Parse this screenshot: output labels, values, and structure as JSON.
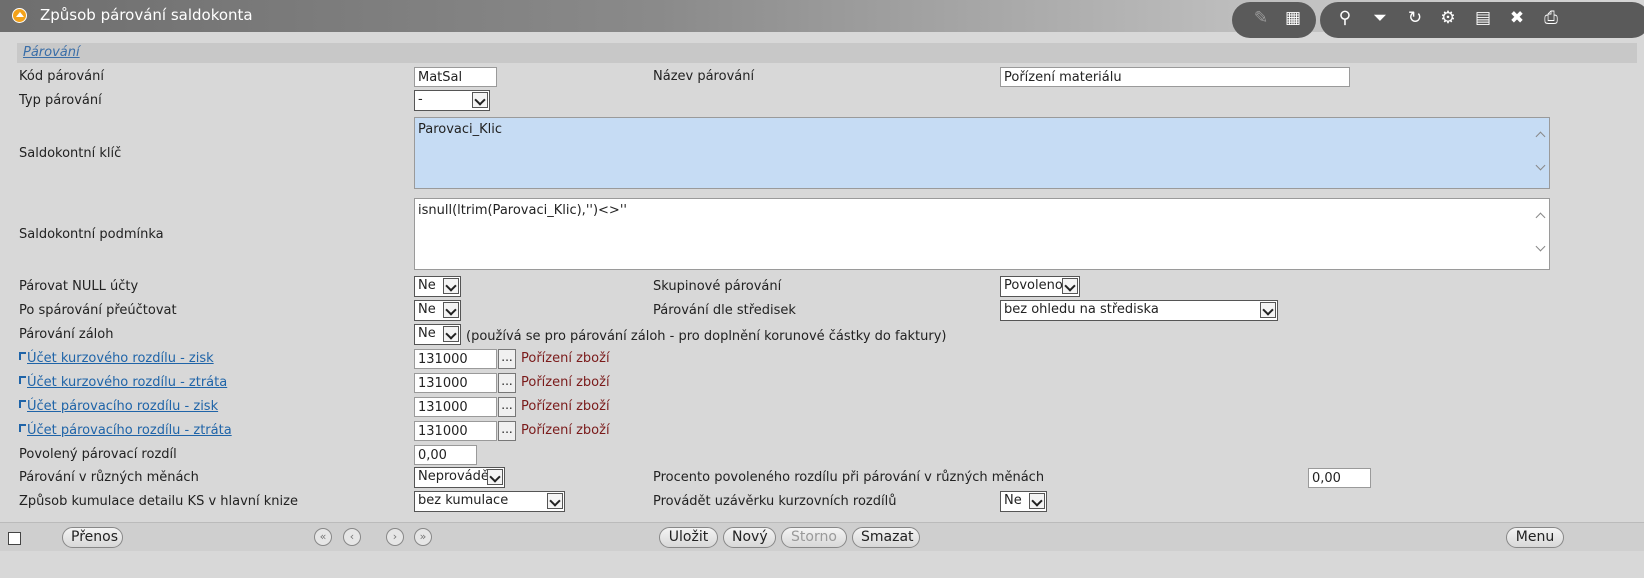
{
  "window": {
    "title": "Způsob párování saldokonta"
  },
  "toolbar": [
    {
      "name": "edit-icon",
      "glyph": "✎",
      "dim": true
    },
    {
      "name": "table-icon",
      "glyph": "▦",
      "dim": false
    },
    {
      "name": "search-icon",
      "glyph": "⚲",
      "dim": false
    },
    {
      "name": "filter-icon",
      "glyph": "⏷",
      "dim": false
    },
    {
      "name": "refresh-icon",
      "glyph": "↻",
      "dim": false
    },
    {
      "name": "user-settings-icon",
      "glyph": "⚙",
      "dim": false
    },
    {
      "name": "document-icon",
      "glyph": "▤",
      "dim": false
    },
    {
      "name": "excel-icon",
      "glyph": "✖",
      "dim": false
    },
    {
      "name": "print-icon",
      "glyph": "⎙",
      "dim": false
    }
  ],
  "section": {
    "label": "Párování"
  },
  "form": {
    "kod_label": "Kód párování",
    "kod_value": "MatSal",
    "nazev_label": "Název párování",
    "nazev_value": "Pořízení materiálu",
    "typ_label": "Typ párování",
    "typ_value": "-",
    "klic_label": "Saldokontní klíč",
    "klic_value": "Parovaci_Klic",
    "podminka_label": "Saldokontní podmínka",
    "podminka_value": "isnull(ltrim(Parovaci_Klic),'')<>''",
    "null_label": "Párovat NULL účty",
    "null_value": "Ne",
    "skup_label": "Skupinové párování",
    "skup_value": "Povoleno",
    "preuct_label": "Po spárování přeúčtovat",
    "preuct_value": "Ne",
    "stred_label": "Párování dle středisek",
    "stred_value": "bez ohledu na střediska",
    "zaloh_label": "Párování záloh",
    "zaloh_value": "Ne",
    "zaloh_note": "(používá se pro párování záloh - pro doplnění korunové částky do faktury)",
    "accounts": [
      {
        "label": "Účet kurzového rozdílu - zisk",
        "value": "131000",
        "name": "Pořízení zboží"
      },
      {
        "label": "Účet kurzového rozdílu - ztráta",
        "value": "131000",
        "name": "Pořízení zboží"
      },
      {
        "label": "Účet párovacího rozdílu - zisk",
        "value": "131000",
        "name": "Pořízení zboží"
      },
      {
        "label": "Účet párovacího rozdílu - ztráta",
        "value": "131000",
        "name": "Pořízení zboží"
      }
    ],
    "povol_label": "Povolený párovací rozdíl",
    "povol_value": "0,00",
    "meny_label": "Párování v různých měnách",
    "meny_value": "Neprovádět",
    "procento_label": "Procento povoleného rozdílu při párování v různých měnách",
    "procento_value": "0,00",
    "kumul_label": "Způsob kumulace detailu KS v hlavní knize",
    "kumul_value": "bez kumulace",
    "uzav_label": "Provádět uzávěrku kurzovních rozdílů",
    "uzav_value": "Ne",
    "dots": "..."
  },
  "bottom": {
    "prenos": "Přenos",
    "ulozit": "Uložit",
    "novy": "Nový",
    "storno": "Storno",
    "smazat": "Smazat",
    "menu": "Menu",
    "nav": [
      "«",
      "‹",
      "›",
      "»"
    ]
  }
}
